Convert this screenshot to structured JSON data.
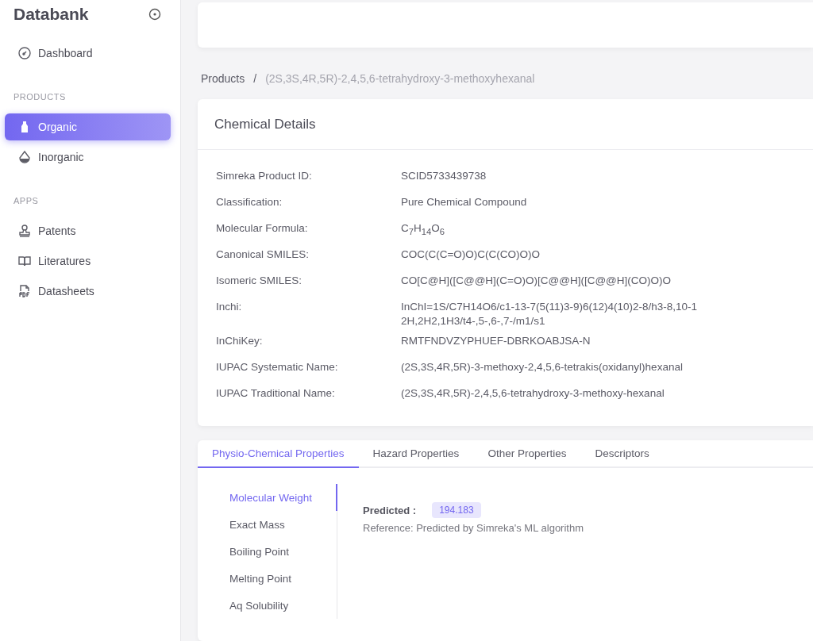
{
  "sidebar": {
    "brand": "Databank",
    "items": [
      {
        "kind": "link",
        "label": "Dashboard",
        "selected": false
      },
      {
        "kind": "heading",
        "label": "PRODUCTS"
      },
      {
        "kind": "link",
        "label": "Organic",
        "selected": true
      },
      {
        "kind": "link",
        "label": "Inorganic",
        "selected": false
      },
      {
        "kind": "heading",
        "label": "APPS"
      },
      {
        "kind": "link",
        "label": "Patents",
        "selected": false
      },
      {
        "kind": "link",
        "label": "Literatures",
        "selected": false
      },
      {
        "kind": "link",
        "label": "Datasheets",
        "selected": false
      }
    ]
  },
  "breadcrumb": [
    "Products",
    "/",
    "(2S,3S,4R,5R)-2,4,5,6-tetrahydroxy-3-methoxyhexanal"
  ],
  "details": {
    "title": "Chemical Details",
    "rows": [
      {
        "label": "Simreka Product ID:",
        "value": "SCID5733439738"
      },
      {
        "label": "Classification:",
        "value": "Pure Chemical Compound"
      },
      {
        "label": "Molecular Formula:",
        "value": "C$_{7}$H$_{14}$O$_{6}$"
      },
      {
        "label": "Canonical SMILES:",
        "value": "COC(C(C=O)O)C(C(CO)O)O"
      },
      {
        "label": "Isomeric SMILES:",
        "value": "CO[C@H]([C@@H](C=O)O)[C@@H]([C@@H](CO)O)O"
      },
      {
        "label": "Inchi:",
        "value": "InChI=1S/C7H14O6/c1-13-7(5(11)3-9)6(12)4(10)2-8/h3-8,10-12H,2H2,1H3/t4-,5-,6-,7-/m1/s1"
      },
      {
        "label": "InChiKey:",
        "value": "RMTFNDVZYPHUEF-DBRKOABJSA-N"
      },
      {
        "label": "IUPAC Systematic Name:",
        "value": "(2S,3S,4R,5R)-3-methoxy-2,4,5,6-tetrakis(oxidanyl)hexanal"
      },
      {
        "label": "IUPAC Traditional Name:",
        "value": "(2S,3S,4R,5R)-2,4,5,6-tetrahydroxy-3-methoxy-hexanal"
      }
    ]
  },
  "tabs": [
    {
      "label": "Physio-Chemical Properties",
      "selected": true
    },
    {
      "label": "Hazard Properties",
      "selected": false
    },
    {
      "label": "Other Properties",
      "selected": false
    },
    {
      "label": "Descriptors",
      "selected": false
    }
  ],
  "properties": [
    {
      "label": "Molecular Weight",
      "selected": true
    },
    {
      "label": "Exact Mass",
      "selected": false
    },
    {
      "label": "Boiling Point",
      "selected": false
    },
    {
      "label": "Melting Point",
      "selected": false
    },
    {
      "label": "Aq Solubility",
      "selected": false
    }
  ],
  "result": {
    "label": "Predicted :",
    "value": "194.183",
    "reference": "Reference: Predicted by Simreka's ML algorithm"
  }
}
